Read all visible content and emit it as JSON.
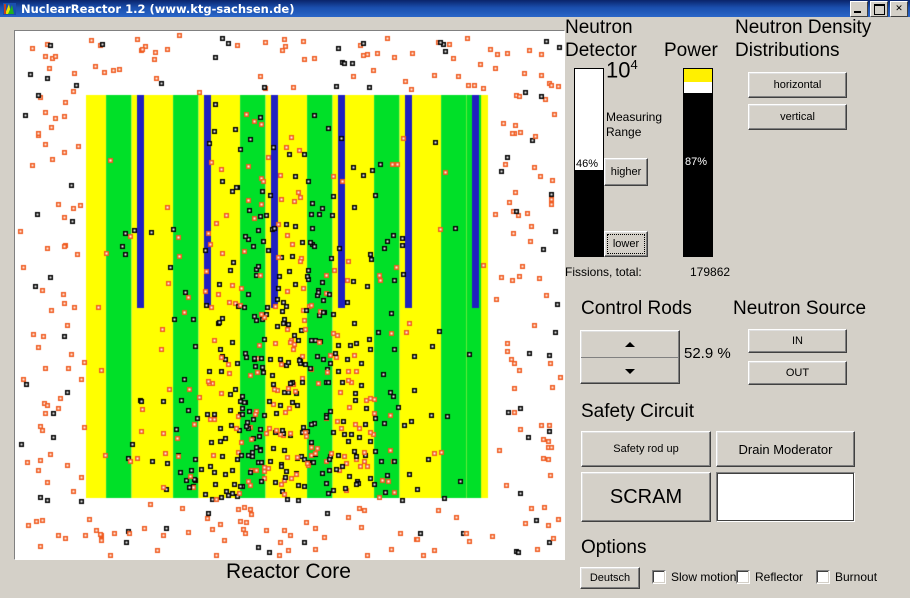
{
  "window": {
    "title": "NuclearReactor 1.2 (www.ktg-sachsen.de)",
    "minimize_label": "minimize",
    "maximize_label": "maximize",
    "close_label": "✕"
  },
  "core": {
    "label": "Reactor Core",
    "colors": {
      "fuel_yellow": "#FFFF00",
      "moderator_green": "#00E028",
      "control_rod_blue": "#2020C0",
      "background": "#FFFFFF",
      "neutron_black": "#000000",
      "neutron_orange": "#F05A1E"
    },
    "control_rod_insertion_percent": 52.9,
    "rod_count": 6
  },
  "neutron_detector": {
    "heading_line1": "Neutron",
    "heading_line2": "Detector",
    "range_exponent_base": "10",
    "range_exponent": "4",
    "measuring_label_line1": "Measuring",
    "measuring_label_line2": "Range",
    "bar_percent": "46%",
    "bar_value": 46,
    "higher_label": "higher",
    "lower_label": "lower"
  },
  "power": {
    "heading": "Power",
    "bar_percent": "87%",
    "bar_value": 87
  },
  "fissions": {
    "label": "Fissions, total:",
    "value": "179862"
  },
  "density": {
    "heading_line1": "Neutron Density",
    "heading_line2": "Distributions",
    "horizontal_label": "horizontal",
    "vertical_label": "vertical"
  },
  "control_rods": {
    "heading": "Control Rods",
    "up_label": "up",
    "down_label": "down",
    "value": "52.9 %"
  },
  "neutron_source": {
    "heading": "Neutron Source",
    "in_label": "IN",
    "out_label": "OUT"
  },
  "safety": {
    "heading": "Safety Circuit",
    "safety_rod_label": "Safety rod up",
    "drain_label": "Drain Moderator",
    "scram_label": "SCRAM",
    "status_value": ""
  },
  "options": {
    "heading": "Options",
    "language_label": "Deutsch",
    "checkboxes": [
      {
        "label": "Slow motion",
        "checked": false
      },
      {
        "label": "Reflector",
        "checked": false
      },
      {
        "label": "Burnout",
        "checked": false
      }
    ]
  }
}
